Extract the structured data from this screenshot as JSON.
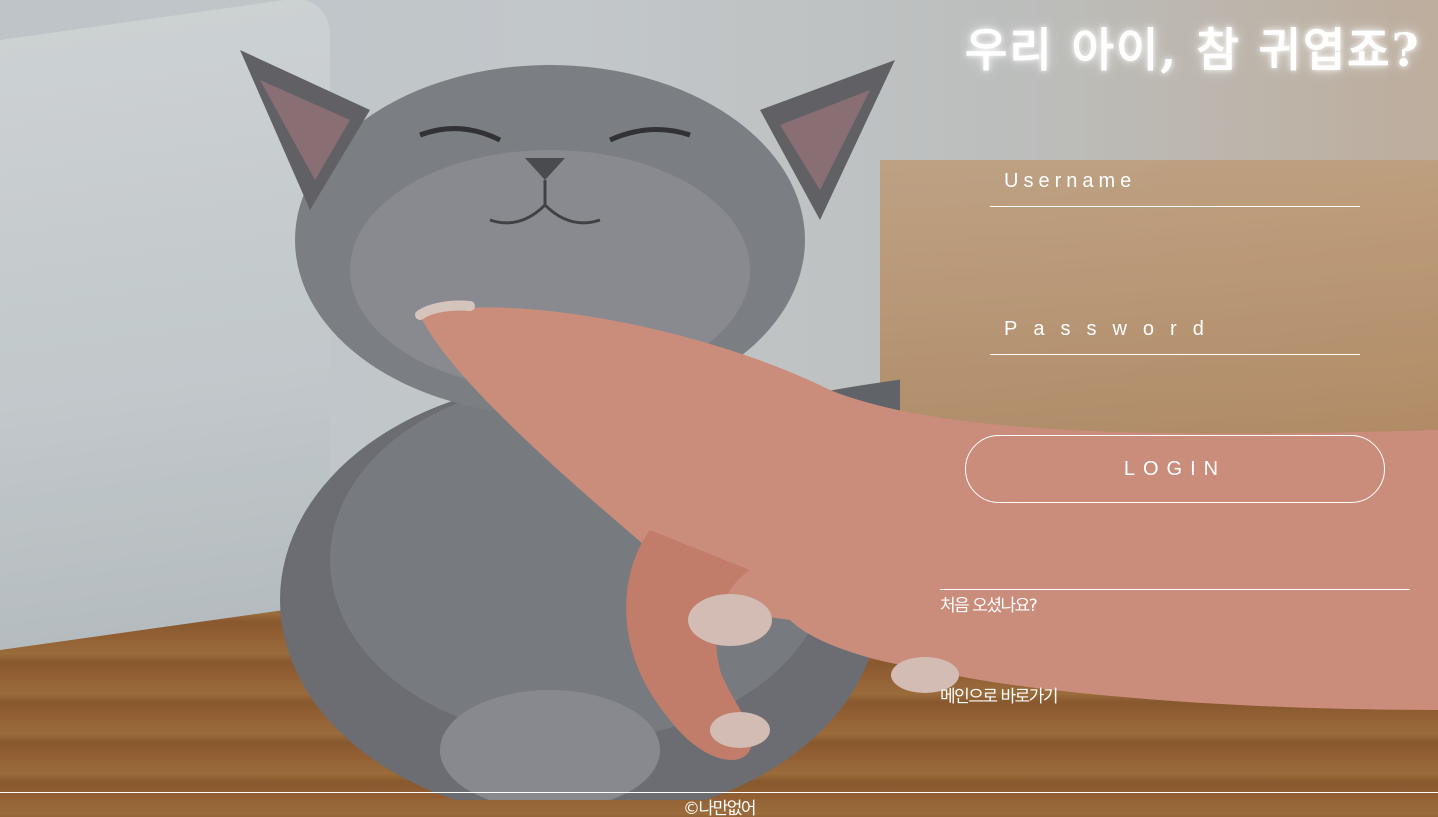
{
  "page": {
    "title": "우리 아이, 참 귀엽죠?"
  },
  "login_form": {
    "username_placeholder": "Username",
    "password_placeholder": "Password",
    "login_label": "LOGIN"
  },
  "links": {
    "signup": "처음 오셨나요?",
    "home": "메인으로 바로가기"
  },
  "footer": {
    "copyright": "©나만없어"
  },
  "background": {
    "image": "cat-photo"
  }
}
